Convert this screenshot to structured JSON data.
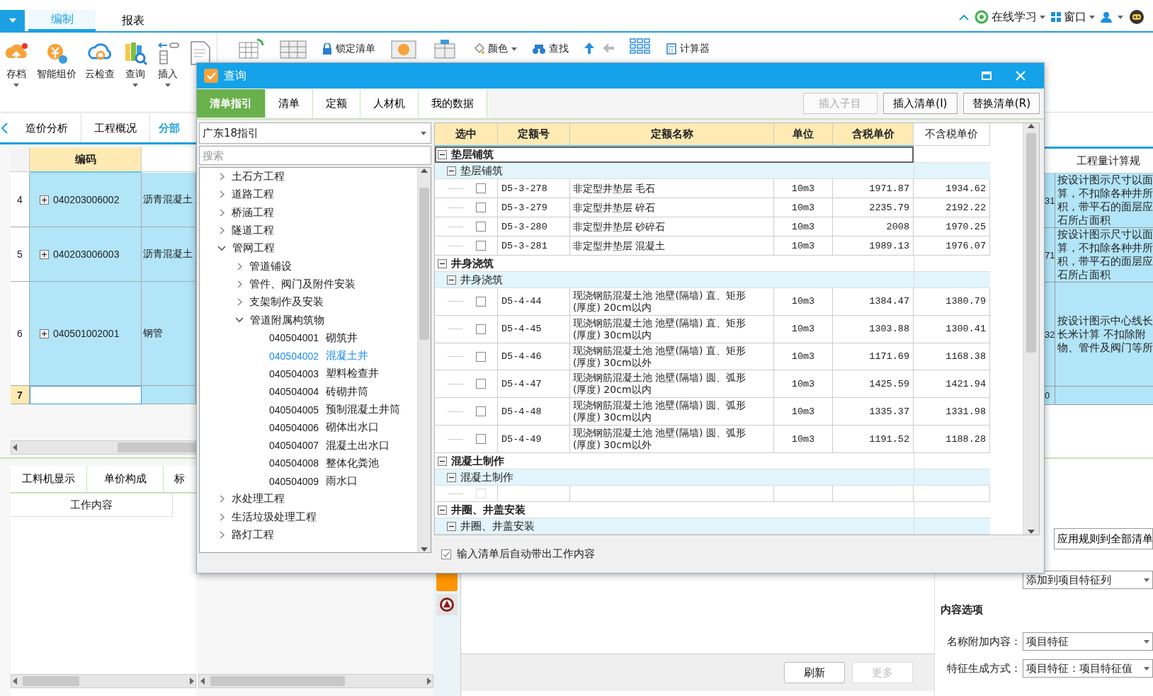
{
  "top_bar": {
    "menu_tabs": [
      {
        "label": "编制",
        "selected": true
      },
      {
        "label": "报表",
        "selected": false
      }
    ],
    "right_items": [
      "在线学习",
      "窗口"
    ]
  },
  "ribbon": {
    "buttons": [
      {
        "label": "存档",
        "dropdown": true
      },
      {
        "label": "智能组价",
        "dropdown": false
      },
      {
        "label": "云检查",
        "dropdown": false
      },
      {
        "label": "查询",
        "dropdown": true
      },
      {
        "label": "插入",
        "dropdown": true
      }
    ],
    "small_buttons": [
      "锁定清单",
      "颜色",
      "查找",
      "计算器"
    ]
  },
  "view_tabs": [
    {
      "label": "造价分析",
      "selected": false
    },
    {
      "label": "工程概况",
      "selected": false
    },
    {
      "label": "分部",
      "selected": true
    }
  ],
  "grid": {
    "code_header": "编码",
    "rows": [
      {
        "number": "4",
        "code": "040203006002",
        "name": "沥青混凝土",
        "current": false
      },
      {
        "number": "5",
        "code": "040203006003",
        "name": "沥青混凝土",
        "current": false
      },
      {
        "number": "6",
        "code": "040501002001",
        "name": "钢管",
        "current": false
      },
      {
        "number": "7",
        "current": true
      }
    ]
  },
  "rules_grid": {
    "header": "工程量计算规",
    "rows": [
      {
        "column_1": "31",
        "rule": "按设计图示尺寸以面算，不扣除各种井所积，带平石的面层应石所占面积"
      },
      {
        "column_1": "71",
        "rule": "按设计图示尺寸以面算，不扣除各种井所积，带平石的面层应石所占面积"
      },
      {
        "column_1": "32",
        "rule": "按设计图示中心线长长米计算 不扣除附物、管件及阀门等所"
      },
      {
        "column_1": "0"
      }
    ]
  },
  "detail_tabs": [
    "工料机显示",
    "单价构成",
    "标"
  ],
  "work_content": {
    "header": "工作内容"
  },
  "bottom_buttons": [
    {
      "label": "刷新",
      "disabled": false
    },
    {
      "label": "更多",
      "disabled": true
    }
  ],
  "settings": {
    "apply_button": "应用规则到全部清单",
    "position_value": "添加到项目特征列",
    "section_title": "内容选项",
    "fields": [
      {
        "label": "名称附加内容：",
        "value": "项目特征"
      },
      {
        "label": "特征生成方式：",
        "value": "项目特征：项目特征值"
      }
    ]
  },
  "dialog": {
    "title": "查询",
    "tabs": [
      {
        "label": "清单指引",
        "selected": true
      },
      {
        "label": "清单",
        "selected": false
      },
      {
        "label": "定额",
        "selected": false
      },
      {
        "label": "人材机",
        "selected": false
      },
      {
        "label": "我的数据",
        "selected": false
      }
    ],
    "buttons": [
      {
        "label": "插入子目",
        "disabled": true
      },
      {
        "label": "插入清单(I)",
        "disabled": false
      },
      {
        "label": "替换清单(R)",
        "disabled": false
      }
    ],
    "library": {
      "value": "广东18指引"
    },
    "search": {
      "placeholder": "搜索"
    },
    "tree": [
      {
        "kind": "folder",
        "label": "土石方工程",
        "expanded": false
      },
      {
        "kind": "folder",
        "label": "道路工程",
        "expanded": false
      },
      {
        "kind": "folder",
        "label": "桥涵工程",
        "expanded": false
      },
      {
        "kind": "folder",
        "label": "隧道工程",
        "expanded": false
      },
      {
        "kind": "folder",
        "label": "管网工程",
        "expanded": true,
        "children": [
          {
            "kind": "folder",
            "label": "管道铺设",
            "expanded": false
          },
          {
            "kind": "folder",
            "label": "管件、阀门及附件安装",
            "expanded": false
          },
          {
            "kind": "folder",
            "label": "支架制作及安装",
            "expanded": false
          },
          {
            "kind": "folder",
            "label": "管道附属构筑物",
            "expanded": true,
            "children": [
              {
                "kind": "leaf",
                "code": "040504001",
                "label": "砌筑井",
                "selected": false
              },
              {
                "kind": "leaf",
                "code": "040504002",
                "label": "混凝土井",
                "selected": true
              },
              {
                "kind": "leaf",
                "code": "040504003",
                "label": "塑料检查井",
                "selected": false
              },
              {
                "kind": "leaf",
                "code": "040504004",
                "label": "砖砌井筒",
                "selected": false
              },
              {
                "kind": "leaf",
                "code": "040504005",
                "label": "预制混凝土井筒",
                "selected": false
              },
              {
                "kind": "leaf",
                "code": "040504006",
                "label": "砌体出水口",
                "selected": false
              },
              {
                "kind": "leaf",
                "code": "040504007",
                "label": "混凝土出水口",
                "selected": false
              },
              {
                "kind": "leaf",
                "code": "040504008",
                "label": "整体化粪池",
                "selected": false
              },
              {
                "kind": "leaf",
                "code": "040504009",
                "label": "雨水口",
                "selected": false
              }
            ]
          }
        ]
      },
      {
        "kind": "folder",
        "label": "水处理工程",
        "expanded": false
      },
      {
        "kind": "folder",
        "label": "生活垃圾处理工程",
        "expanded": false
      },
      {
        "kind": "folder",
        "label": "路灯工程",
        "expanded": false
      }
    ],
    "table": {
      "columns": [
        {
          "label": "选中",
          "highlighted": true
        },
        {
          "label": "定额号",
          "highlighted": true
        },
        {
          "label": "定额名称",
          "highlighted": true
        },
        {
          "label": "单位",
          "highlighted": true
        },
        {
          "label": "含税单价",
          "highlighted": true
        },
        {
          "label": "不含税单价",
          "highlighted": false
        }
      ],
      "groups": [
        {
          "title": "垫层铺筑",
          "expanded": true,
          "focused": true,
          "children": [
            {
              "title": "垫层铺筑",
              "expanded": true,
              "items": [
                {
                  "code": "D5-3-278",
                  "name": "非定型井垫层 毛石",
                  "unit": "10m3",
                  "price": "1971.87",
                  "price_ex": "1934.62",
                  "checked": false,
                  "disabled": false
                },
                {
                  "code": "D5-3-279",
                  "name": "非定型井垫层 碎石",
                  "unit": "10m3",
                  "price": "2235.79",
                  "price_ex": "2192.22",
                  "checked": false,
                  "disabled": false
                },
                {
                  "code": "D5-3-280",
                  "name": "非定型井垫层 砂碎石",
                  "unit": "10m3",
                  "price": "2008",
                  "price_ex": "1970.25",
                  "checked": false,
                  "disabled": false
                },
                {
                  "code": "D5-3-281",
                  "name": "非定型井垫层 混凝土",
                  "unit": "10m3",
                  "price": "1989.13",
                  "price_ex": "1976.07",
                  "checked": false,
                  "disabled": false
                }
              ]
            }
          ]
        },
        {
          "title": "井身浇筑",
          "expanded": true,
          "focused": false,
          "children": [
            {
              "title": "井身浇筑",
              "expanded": true,
              "items": [
                {
                  "code": "D5-4-44",
                  "name": "现浇钢筋混凝土池 池壁(隔墙) 直、矩形\n(厚度) 20cm以内",
                  "unit": "10m3",
                  "price": "1384.47",
                  "price_ex": "1380.79",
                  "checked": false,
                  "disabled": false
                },
                {
                  "code": "D5-4-45",
                  "name": "现浇钢筋混凝土池 池壁(隔墙) 直、矩形\n(厚度) 30cm以内",
                  "unit": "10m3",
                  "price": "1303.88",
                  "price_ex": "1300.41",
                  "checked": false,
                  "disabled": false
                },
                {
                  "code": "D5-4-46",
                  "name": "现浇钢筋混凝土池 池壁(隔墙) 直、矩形\n(厚度) 30cm以外",
                  "unit": "10m3",
                  "price": "1171.69",
                  "price_ex": "1168.38",
                  "checked": false,
                  "disabled": false
                },
                {
                  "code": "D5-4-47",
                  "name": "现浇钢筋混凝土池 池壁(隔墙) 圆、弧形\n(厚度) 20cm以内",
                  "unit": "10m3",
                  "price": "1425.59",
                  "price_ex": "1421.94",
                  "checked": false,
                  "disabled": false
                },
                {
                  "code": "D5-4-48",
                  "name": "现浇钢筋混凝土池 池壁(隔墙) 圆、弧形\n(厚度) 30cm以内",
                  "unit": "10m3",
                  "price": "1335.37",
                  "price_ex": "1331.98",
                  "checked": false,
                  "disabled": false
                },
                {
                  "code": "D5-4-49",
                  "name": "现浇钢筋混凝土池 池壁(隔墙) 圆、弧形\n(厚度) 30cm以外",
                  "unit": "10m3",
                  "price": "1191.52",
                  "price_ex": "1188.28",
                  "checked": false,
                  "disabled": false
                }
              ]
            }
          ]
        },
        {
          "title": "混凝土制作",
          "expanded": true,
          "focused": false,
          "children": [
            {
              "title": "混凝土制作",
              "expanded": true,
              "items": [
                {
                  "checked": false,
                  "disabled": true
                }
              ]
            }
          ]
        },
        {
          "title": "井圈、井盖安装",
          "expanded": true,
          "focused": false,
          "children": [
            {
              "title": "井圈、井盖安装",
              "expanded": true
            }
          ]
        }
      ]
    },
    "auto_fill": {
      "label": "输入清单后自动带出工作内容",
      "checked": true
    }
  }
}
